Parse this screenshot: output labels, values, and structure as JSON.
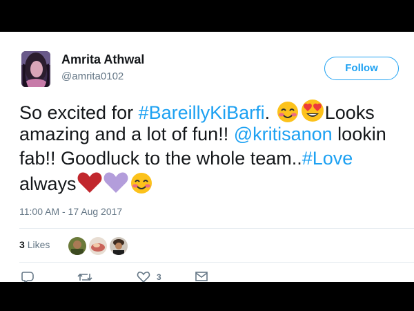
{
  "user": {
    "name": "Amrita Athwal",
    "handle": "@amrita0102",
    "avatar_icon": "profile-photo"
  },
  "follow_button": {
    "label": "Follow"
  },
  "tweet": {
    "line1_a": "So excited for ",
    "line1_hashtag": "#BareillyKiBarfi",
    "line1_b": ". ",
    "line1_c": "Looks",
    "line2_a": "amazing and a lot of fun!! ",
    "line2_mention": "@kritisanon",
    "line2_b": " lookin",
    "line3_a": "fab!! Goodluck to the whole team..",
    "line3_hashtag": "#Love",
    "line4_a": "always",
    "emojis": [
      "smiling-face-blush-icon",
      "heart-eyes-icon",
      "red-heart-icon",
      "purple-heart-icon",
      "smiling-face-blush-icon"
    ]
  },
  "timestamp": "11:00 AM - 17 Aug 2017",
  "likes": {
    "count": "3",
    "label": "Likes"
  },
  "actions": {
    "reply_icon": "reply-icon",
    "retweet_icon": "retweet-icon",
    "like_icon": "heart-outline-icon",
    "like_count": "3",
    "message_icon": "envelope-icon"
  },
  "colors": {
    "accent": "#1da1f2",
    "text": "#14171a",
    "secondary": "#657786",
    "divider": "#e6ecf0"
  }
}
